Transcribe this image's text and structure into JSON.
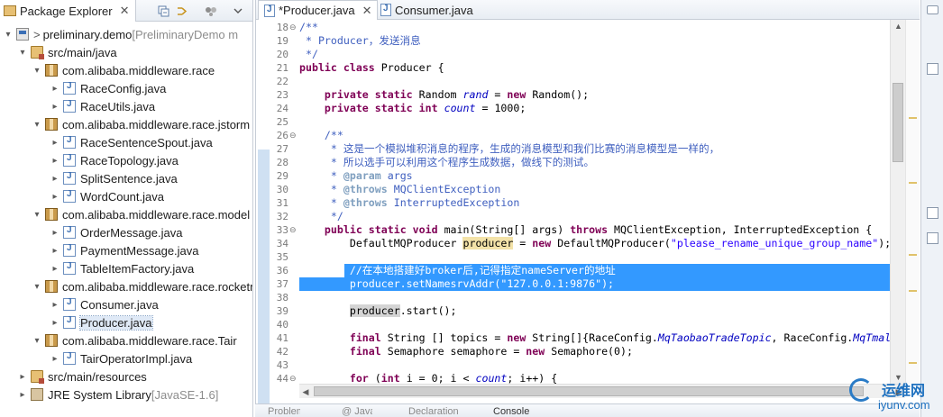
{
  "explorer": {
    "title": "Package Explorer",
    "close": "✕",
    "tree": [
      {
        "arrow": "▾",
        "icon": "project",
        "prefix": "> ",
        "label": "preliminary.demo",
        "decoration": " [PreliminaryDemo m"
      },
      {
        "arrow": "▾",
        "icon": "srcfolder",
        "label": "src/main/java"
      },
      {
        "arrow": "▾",
        "icon": "package",
        "label": "com.alibaba.middleware.race"
      },
      {
        "arrow": "▸",
        "icon": "java",
        "label": "RaceConfig.java"
      },
      {
        "arrow": "▸",
        "icon": "java",
        "label": "RaceUtils.java"
      },
      {
        "arrow": "▾",
        "icon": "package",
        "label": "com.alibaba.middleware.race.jstorm"
      },
      {
        "arrow": "▸",
        "icon": "java",
        "label": "RaceSentenceSpout.java"
      },
      {
        "arrow": "▸",
        "icon": "java",
        "label": "RaceTopology.java"
      },
      {
        "arrow": "▸",
        "icon": "java",
        "label": "SplitSentence.java"
      },
      {
        "arrow": "▸",
        "icon": "java",
        "label": "WordCount.java"
      },
      {
        "arrow": "▾",
        "icon": "package",
        "label": "com.alibaba.middleware.race.model"
      },
      {
        "arrow": "▸",
        "icon": "java",
        "label": "OrderMessage.java"
      },
      {
        "arrow": "▸",
        "icon": "java",
        "label": "PaymentMessage.java"
      },
      {
        "arrow": "▸",
        "icon": "java",
        "label": "TableItemFactory.java"
      },
      {
        "arrow": "▾",
        "icon": "package",
        "label": "com.alibaba.middleware.race.rocketmq"
      },
      {
        "arrow": "▸",
        "icon": "java",
        "label": "Consumer.java"
      },
      {
        "arrow": "▸",
        "icon": "java",
        "label": "Producer.java",
        "selected": true
      },
      {
        "arrow": "▾",
        "icon": "package",
        "label": "com.alibaba.middleware.race.Tair"
      },
      {
        "arrow": "▸",
        "icon": "java",
        "label": "TairOperatorImpl.java"
      },
      {
        "arrow": "▸",
        "icon": "srcfolder",
        "label": "src/main/resources"
      },
      {
        "arrow": "▸",
        "icon": "jre",
        "label": "JRE System Library",
        "decoration": " [JavaSE-1.6]"
      }
    ]
  },
  "editor": {
    "tabs": [
      {
        "label": "*Producer.java",
        "close": "✕",
        "active": true
      },
      {
        "label": "Consumer.java",
        "active": false
      }
    ],
    "lines": [
      {
        "n": "18",
        "fold": "⊖",
        "parts": [
          [
            "cm",
            "/**"
          ]
        ]
      },
      {
        "n": "19",
        "parts": [
          [
            "cm",
            " * Producer，发送消息"
          ]
        ]
      },
      {
        "n": "20",
        "parts": [
          [
            "cm",
            " */"
          ]
        ]
      },
      {
        "n": "21",
        "parts": [
          [
            "kw",
            "public"
          ],
          [
            "p",
            " "
          ],
          [
            "kw",
            "class"
          ],
          [
            "p",
            " Producer {"
          ]
        ]
      },
      {
        "n": "22",
        "parts": []
      },
      {
        "n": "23",
        "parts": [
          [
            "p",
            "    "
          ],
          [
            "kw",
            "private"
          ],
          [
            "p",
            " "
          ],
          [
            "kw",
            "static"
          ],
          [
            "p",
            " Random "
          ],
          [
            "fld",
            "rand"
          ],
          [
            "p",
            " = "
          ],
          [
            "kw",
            "new"
          ],
          [
            "p",
            " Random();"
          ]
        ]
      },
      {
        "n": "24",
        "parts": [
          [
            "p",
            "    "
          ],
          [
            "kw",
            "private"
          ],
          [
            "p",
            " "
          ],
          [
            "kw",
            "static"
          ],
          [
            "p",
            " "
          ],
          [
            "kw",
            "int"
          ],
          [
            "p",
            " "
          ],
          [
            "fld",
            "count"
          ],
          [
            "p",
            " = 1000;"
          ]
        ]
      },
      {
        "n": "25",
        "parts": []
      },
      {
        "n": "26",
        "fold": "⊖",
        "parts": [
          [
            "p",
            "    "
          ],
          [
            "cm",
            "/**"
          ]
        ]
      },
      {
        "n": "27",
        "parts": [
          [
            "cm",
            "     * 这是一个模拟堆积消息的程序，生成的消息模型和我们比赛的消息模型是一样的，"
          ]
        ]
      },
      {
        "n": "28",
        "parts": [
          [
            "cm",
            "     * 所以选手可以利用这个程序生成数据，做线下的测试。"
          ]
        ]
      },
      {
        "n": "29",
        "parts": [
          [
            "cm",
            "     * "
          ],
          [
            "tag",
            "@param"
          ],
          [
            "cm",
            " args"
          ]
        ]
      },
      {
        "n": "30",
        "parts": [
          [
            "cm",
            "     * "
          ],
          [
            "tag",
            "@throws"
          ],
          [
            "cm",
            " MQClientException"
          ]
        ]
      },
      {
        "n": "31",
        "parts": [
          [
            "cm",
            "     * "
          ],
          [
            "tag",
            "@throws"
          ],
          [
            "cm",
            " InterruptedException"
          ]
        ]
      },
      {
        "n": "32",
        "parts": [
          [
            "cm",
            "     */"
          ]
        ]
      },
      {
        "n": "33",
        "fold": "⊖",
        "parts": [
          [
            "p",
            "    "
          ],
          [
            "kw",
            "public"
          ],
          [
            "p",
            " "
          ],
          [
            "kw",
            "static"
          ],
          [
            "p",
            " "
          ],
          [
            "kw",
            "void"
          ],
          [
            "p",
            " main(String[] args) "
          ],
          [
            "kw",
            "throws"
          ],
          [
            "p",
            " MQClientException, InterruptedException {"
          ]
        ]
      },
      {
        "n": "34",
        "parts": [
          [
            "p",
            "        DefaultMQProducer "
          ],
          [
            "occ",
            "producer"
          ],
          [
            "p",
            " = "
          ],
          [
            "kw",
            "new"
          ],
          [
            "p",
            " DefaultMQProducer("
          ],
          [
            "str",
            "\"please_rename_unique_group_name\""
          ],
          [
            "p",
            ");"
          ]
        ]
      },
      {
        "n": "35",
        "parts": []
      },
      {
        "n": "36",
        "parts": [
          [
            "p",
            "        "
          ],
          [
            "cml",
            "//在本地搭建好broker后,记得指定nameServer的地址"
          ]
        ],
        "partial": true
      },
      {
        "n": "37",
        "hl": true,
        "parts": [
          [
            "p",
            "        producer.setNamesrvAddr("
          ],
          [
            "str",
            "\"127.0.0.1:9876\""
          ],
          [
            "p",
            ");"
          ]
        ]
      },
      {
        "n": "38",
        "parts": []
      },
      {
        "n": "39",
        "parts": [
          [
            "p",
            "        "
          ],
          [
            "loc",
            "producer"
          ],
          [
            "p",
            ".start();"
          ]
        ]
      },
      {
        "n": "40",
        "parts": []
      },
      {
        "n": "41",
        "parts": [
          [
            "p",
            "        "
          ],
          [
            "kw",
            "final"
          ],
          [
            "p",
            " String [] topics = "
          ],
          [
            "kw",
            "new"
          ],
          [
            "p",
            " String[]{RaceConfig."
          ],
          [
            "fld",
            "MqTaobaoTradeTopic"
          ],
          [
            "p",
            ", RaceConfig."
          ],
          [
            "fld",
            "MqTmal"
          ]
        ]
      },
      {
        "n": "42",
        "parts": [
          [
            "p",
            "        "
          ],
          [
            "kw",
            "final"
          ],
          [
            "p",
            " Semaphore semaphore = "
          ],
          [
            "kw",
            "new"
          ],
          [
            "p",
            " Semaphore(0);"
          ]
        ]
      },
      {
        "n": "43",
        "parts": []
      },
      {
        "n": "44",
        "fold": "⊖",
        "parts": [
          [
            "p",
            "        "
          ],
          [
            "kw",
            "for"
          ],
          [
            "p",
            " ("
          ],
          [
            "kw",
            "int"
          ],
          [
            "p",
            " i = 0; i < "
          ],
          [
            "fld",
            "count"
          ],
          [
            "p",
            "; i++) {"
          ]
        ]
      }
    ]
  },
  "bottom_tabs": [
    "Problems",
    "@ Javadoc",
    "Declaration",
    "Console"
  ],
  "watermark": {
    "cn": "运维网",
    "url": "iyunv.com"
  }
}
